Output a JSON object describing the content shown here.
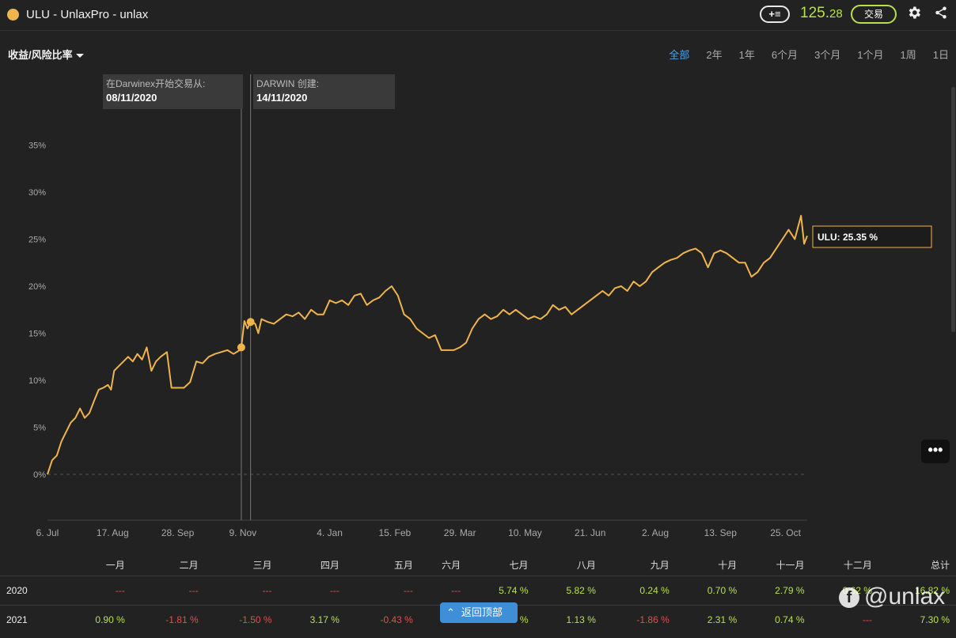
{
  "header": {
    "title": "ULU - UnlaxPro - unlax",
    "price_main": "125.",
    "price_decimals": "28",
    "trade_label": "交易",
    "add_list_label": "+≡"
  },
  "metric_select": "收益/风险比率",
  "range_tabs": [
    "全部",
    "2年",
    "1年",
    "6个月",
    "3个月",
    "1个月",
    "1周",
    "1日"
  ],
  "more_label": "•••",
  "back_to_top": "返回顶部",
  "watermark": "@unlax",
  "colors": {
    "line": "#f0b44c",
    "positive": "#b6e14a",
    "negative": "#e0504c",
    "active_tab": "#4da3e8"
  },
  "chart_data": {
    "type": "line",
    "ylim": [
      -5,
      40
    ],
    "y_ticks": [
      0,
      5,
      10,
      15,
      20,
      25,
      30,
      35
    ],
    "y_tick_labels": [
      "0%",
      "5%",
      "10%",
      "15%",
      "20%",
      "25%",
      "30%",
      "35%"
    ],
    "x_tick_labels": [
      "6. Jul",
      "17. Aug",
      "28. Sep",
      "9. Nov",
      "4. Jan",
      "15. Feb",
      "29. Mar",
      "10. May",
      "21. Jun",
      "2. Aug",
      "13. Sep",
      "25. Oct"
    ],
    "x_tick_index": [
      0,
      42,
      84,
      126,
      182,
      224,
      266,
      308,
      350,
      392,
      434,
      476
    ],
    "x_max_index": 490,
    "annotations": [
      {
        "label": "在Darwinex开始交易从:",
        "date": "08/11/2020",
        "x_index": 125,
        "value": 13.5
      },
      {
        "label": "DARWIN 创建:",
        "date": "14/11/2020",
        "x_index": 131,
        "value": 16.2
      }
    ],
    "series": [
      {
        "name": "ULU",
        "last_label": "ULU: 25.35 %",
        "points": [
          [
            0,
            0
          ],
          [
            3,
            1.5
          ],
          [
            6,
            2
          ],
          [
            9,
            3.5
          ],
          [
            12,
            4.5
          ],
          [
            15,
            5.5
          ],
          [
            18,
            6
          ],
          [
            21,
            7
          ],
          [
            24,
            6
          ],
          [
            27,
            6.5
          ],
          [
            30,
            7.8
          ],
          [
            33,
            9
          ],
          [
            36,
            9.2
          ],
          [
            39,
            9.5
          ],
          [
            41,
            9
          ],
          [
            43,
            11
          ],
          [
            46,
            11.5
          ],
          [
            49,
            12
          ],
          [
            52,
            12.5
          ],
          [
            55,
            12
          ],
          [
            58,
            12.8
          ],
          [
            61,
            12.2
          ],
          [
            64,
            13.5
          ],
          [
            67,
            11
          ],
          [
            70,
            12
          ],
          [
            73,
            12.5
          ],
          [
            77,
            13
          ],
          [
            80,
            9.2
          ],
          [
            84,
            9.2
          ],
          [
            88,
            9.2
          ],
          [
            92,
            9.8
          ],
          [
            96,
            12
          ],
          [
            100,
            11.8
          ],
          [
            104,
            12.5
          ],
          [
            108,
            12.8
          ],
          [
            112,
            13
          ],
          [
            116,
            13.2
          ],
          [
            120,
            12.8
          ],
          [
            124,
            13.2
          ],
          [
            125,
            13.5
          ],
          [
            127,
            16.3
          ],
          [
            129,
            15.5
          ],
          [
            131,
            16.2
          ],
          [
            134,
            16
          ],
          [
            136,
            15
          ],
          [
            138,
            16.5
          ],
          [
            142,
            16.2
          ],
          [
            146,
            16
          ],
          [
            150,
            16.5
          ],
          [
            154,
            17
          ],
          [
            158,
            16.8
          ],
          [
            162,
            17.2
          ],
          [
            166,
            16.5
          ],
          [
            170,
            17.5
          ],
          [
            174,
            17
          ],
          [
            178,
            17
          ],
          [
            182,
            18.5
          ],
          [
            186,
            18.2
          ],
          [
            190,
            18.5
          ],
          [
            194,
            18
          ],
          [
            198,
            19
          ],
          [
            202,
            19.2
          ],
          [
            206,
            18
          ],
          [
            210,
            18.5
          ],
          [
            214,
            18.8
          ],
          [
            218,
            19.5
          ],
          [
            222,
            20
          ],
          [
            226,
            19
          ],
          [
            230,
            17
          ],
          [
            234,
            16.5
          ],
          [
            238,
            15.5
          ],
          [
            242,
            15
          ],
          [
            246,
            14.5
          ],
          [
            250,
            14.8
          ],
          [
            254,
            13.2
          ],
          [
            258,
            13.2
          ],
          [
            262,
            13.2
          ],
          [
            266,
            13.5
          ],
          [
            270,
            14
          ],
          [
            274,
            15.5
          ],
          [
            278,
            16.5
          ],
          [
            282,
            17
          ],
          [
            286,
            16.5
          ],
          [
            290,
            16.8
          ],
          [
            294,
            17.5
          ],
          [
            298,
            17
          ],
          [
            302,
            17.5
          ],
          [
            306,
            17
          ],
          [
            310,
            16.5
          ],
          [
            314,
            16.8
          ],
          [
            318,
            16.5
          ],
          [
            322,
            17
          ],
          [
            326,
            18
          ],
          [
            330,
            17.5
          ],
          [
            334,
            17.8
          ],
          [
            338,
            17
          ],
          [
            342,
            17.5
          ],
          [
            346,
            18
          ],
          [
            350,
            18.5
          ],
          [
            354,
            19
          ],
          [
            358,
            19.5
          ],
          [
            362,
            19
          ],
          [
            366,
            19.8
          ],
          [
            370,
            20
          ],
          [
            374,
            19.5
          ],
          [
            378,
            20.5
          ],
          [
            382,
            20
          ],
          [
            386,
            20.5
          ],
          [
            390,
            21.5
          ],
          [
            394,
            22
          ],
          [
            398,
            22.5
          ],
          [
            402,
            22.8
          ],
          [
            406,
            23
          ],
          [
            410,
            23.5
          ],
          [
            414,
            23.8
          ],
          [
            418,
            24
          ],
          [
            422,
            23.5
          ],
          [
            426,
            22
          ],
          [
            430,
            23.5
          ],
          [
            434,
            23.8
          ],
          [
            438,
            23.5
          ],
          [
            442,
            23
          ],
          [
            446,
            22.5
          ],
          [
            450,
            22.5
          ],
          [
            454,
            21
          ],
          [
            458,
            21.5
          ],
          [
            462,
            22.5
          ],
          [
            466,
            23
          ],
          [
            470,
            24
          ],
          [
            474,
            25
          ],
          [
            478,
            26
          ],
          [
            482,
            25
          ],
          [
            486,
            27.5
          ],
          [
            488,
            24.5
          ],
          [
            490,
            25.35
          ]
        ]
      }
    ]
  },
  "table": {
    "headers": [
      "",
      "一月",
      "二月",
      "三月",
      "四月",
      "五月",
      "六月",
      "七月",
      "八月",
      "九月",
      "十月",
      "十一月",
      "十二月",
      "总计"
    ],
    "rows": [
      {
        "year": "2020",
        "values": [
          "---",
          "---",
          "---",
          "---",
          "---",
          "---",
          "5.74 %",
          "5.82 %",
          "0.24 %",
          "0.70 %",
          "2.79 %",
          "0.62 %",
          "16.82 %"
        ]
      },
      {
        "year": "2021",
        "values": [
          "0.90 %",
          "-1.81 %",
          "-1.50 %",
          "3.17 %",
          "-0.43 %",
          "",
          "0.00 %",
          "1.13 %",
          "-1.86 %",
          "2.31 %",
          "0.74 %",
          "---",
          "7.30 %"
        ]
      }
    ]
  }
}
